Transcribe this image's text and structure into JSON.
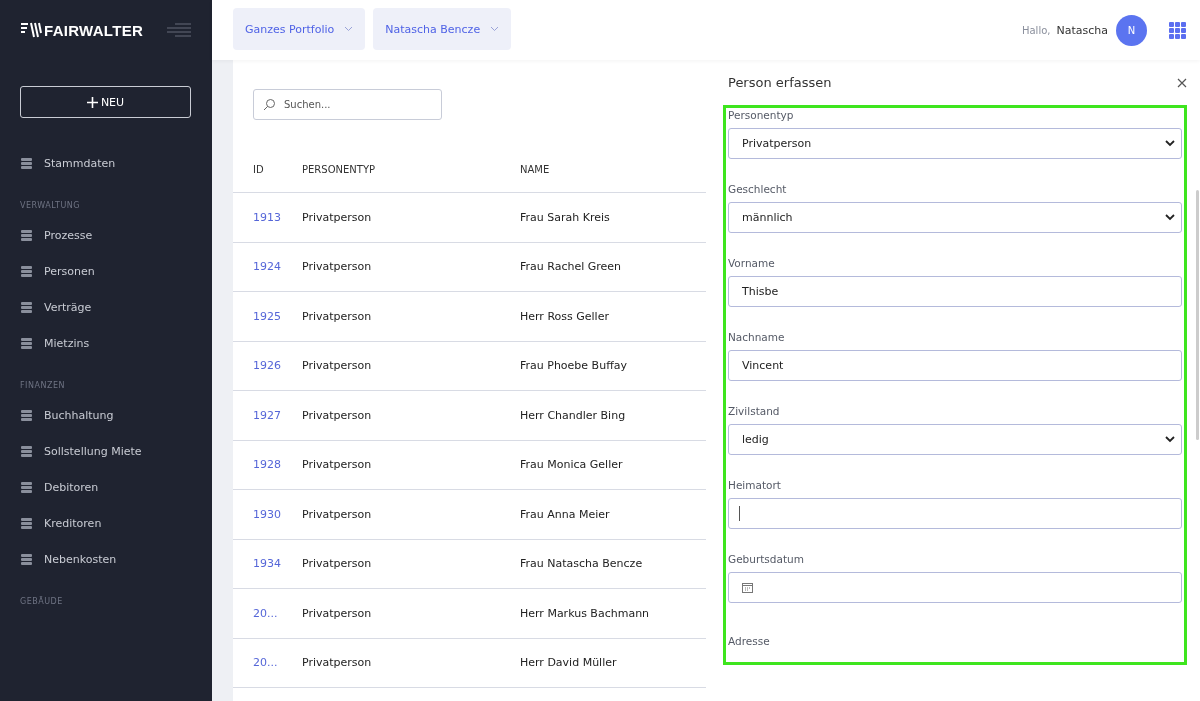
{
  "sidebar": {
    "logo": "FAIRWALTER",
    "new_button": "NEU",
    "sections": [
      {
        "items": [
          "Stammdaten"
        ]
      },
      {
        "title": "VERWALTUNG",
        "items": [
          "Prozesse",
          "Personen",
          "Verträge",
          "Mietzins"
        ]
      },
      {
        "title": "FINANZEN",
        "items": [
          "Buchhaltung",
          "Sollstellung Miete",
          "Debitoren",
          "Kreditoren",
          "Nebenkosten"
        ]
      },
      {
        "title": "GEBÄUDE"
      }
    ]
  },
  "topbar": {
    "filters": [
      "Ganzes Portfolio",
      "Natascha Bencze"
    ],
    "greeting": "Hallo,",
    "user": "Natascha",
    "avatar": "N"
  },
  "search": {
    "placeholder": "Suchen..."
  },
  "table": {
    "columns": [
      "ID",
      "PERSONENTYP",
      "NAME"
    ],
    "rows": [
      [
        "1913",
        "Privatperson",
        "Frau Sarah Kreis"
      ],
      [
        "1924",
        "Privatperson",
        "Frau Rachel Green"
      ],
      [
        "1925",
        "Privatperson",
        "Herr Ross Geller"
      ],
      [
        "1926",
        "Privatperson",
        "Frau Phoebe Buffay"
      ],
      [
        "1927",
        "Privatperson",
        "Herr Chandler Bing"
      ],
      [
        "1928",
        "Privatperson",
        "Frau Monica Geller"
      ],
      [
        "1930",
        "Privatperson",
        "Frau Anna Meier"
      ],
      [
        "1934",
        "Privatperson",
        "Frau Natascha Bencze"
      ],
      [
        "20...",
        "Privatperson",
        "Herr Markus Bachmann"
      ],
      [
        "20...",
        "Privatperson",
        "Herr David Müller"
      ]
    ]
  },
  "panel": {
    "title": "Person erfassen",
    "fields": [
      {
        "kind": "select",
        "label": "Personentyp",
        "value": "Privatperson"
      },
      {
        "kind": "select",
        "label": "Geschlecht",
        "value": "männlich"
      },
      {
        "kind": "text",
        "label": "Vorname",
        "value": "Thisbe"
      },
      {
        "kind": "text",
        "label": "Nachname",
        "value": "Vincent"
      },
      {
        "kind": "select",
        "label": "Zivilstand",
        "value": "ledig"
      },
      {
        "kind": "text",
        "label": "Heimatort"
      },
      {
        "kind": "date",
        "label": "Geburtsdatum"
      },
      {
        "kind": "heading",
        "label": "Adresse"
      }
    ]
  }
}
